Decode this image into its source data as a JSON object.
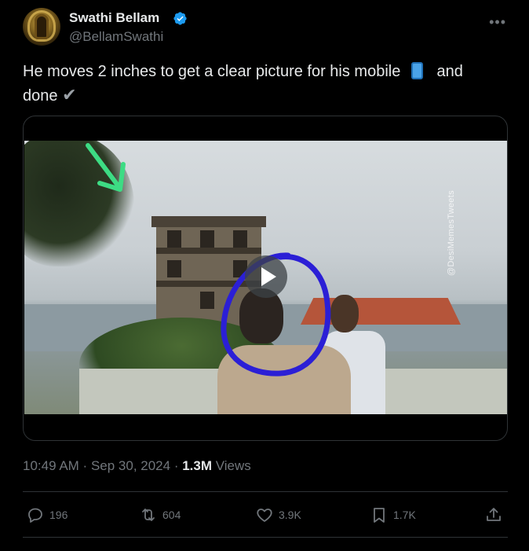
{
  "author": {
    "name": "Swathi Bellam",
    "handle": "@BellamSwathi",
    "verified": true,
    "avatar_icon": "deity-avatar"
  },
  "tweet": {
    "text_part1": "He moves 2 inches to get a clear picture for his mobile",
    "emoji_phone": "mobile-phone-emoji",
    "text_part2": "and",
    "text_part3": "done",
    "emoji_check": "✔"
  },
  "media": {
    "watermark": "@DesiMemesTweets",
    "annotation_color": "#2b1fd6",
    "arrow_color": "#3ddc84"
  },
  "meta": {
    "time": "10:49 AM",
    "dot1": " · ",
    "date": "Sep 30, 2024",
    "dot2": " · ",
    "views_count": "1.3M",
    "views_label": " Views"
  },
  "actions": {
    "replies": "196",
    "reposts": "604",
    "likes": "3.9K",
    "bookmarks": "1.7K"
  },
  "colors": {
    "background": "#000000",
    "text": "#e7e9ea",
    "muted": "#71767b",
    "verified_blue": "#1d9bf0",
    "border": "#2f3336"
  }
}
